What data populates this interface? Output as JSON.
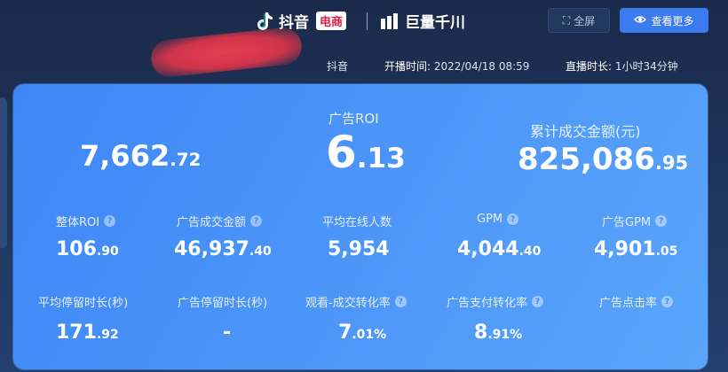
{
  "topbar": {
    "douyin_text": "抖音",
    "shop_badge": "电商",
    "qianchuan_text": "巨量千川",
    "fullscreen_label": "全屏",
    "more_label": "查看更多"
  },
  "info": {
    "platform": "抖音",
    "start_label": "开播时间:",
    "start_value": "2022/04/18 08:59",
    "duration_label": "直播时长:",
    "duration_value": "1小时34分钟"
  },
  "hero": {
    "left_value_int": "7,662",
    "left_value_dec": ".72",
    "roi_label": "广告ROI",
    "roi_int": "6",
    "roi_dec": ".13",
    "gmv_label": "累计成交金额(元)",
    "gmv_int": "825,086",
    "gmv_dec": ".95"
  },
  "row1": [
    {
      "label": "整体ROI",
      "int": "106",
      "dec": ".90",
      "help": "?"
    },
    {
      "label": "广告成交金额",
      "int": "46,937",
      "dec": ".40",
      "help": "?"
    },
    {
      "label": "平均在线人数",
      "int": "5,954",
      "dec": ""
    },
    {
      "label": "GPM",
      "int": "4,044",
      "dec": ".40",
      "help": "?"
    },
    {
      "label": "广告GPM",
      "int": "4,901",
      "dec": ".05",
      "help": "?"
    }
  ],
  "row2": [
    {
      "label": "平均停留时长(秒)",
      "int": "171",
      "dec": ".92"
    },
    {
      "label": "广告停留时长(秒)",
      "int": "-",
      "dec": ""
    },
    {
      "label": "观看-成交转化率",
      "int": "7",
      "dec": ".01%",
      "help": "?"
    },
    {
      "label": "广告支付转化率",
      "int": "8",
      "dec": ".91%",
      "help": "?"
    },
    {
      "label": "广告点击率",
      "int": "",
      "dec": "",
      "help": "?"
    }
  ],
  "colors": {
    "card": "#4b94f8",
    "accent": "#3a7bf0",
    "badge_red": "#e0204a"
  }
}
